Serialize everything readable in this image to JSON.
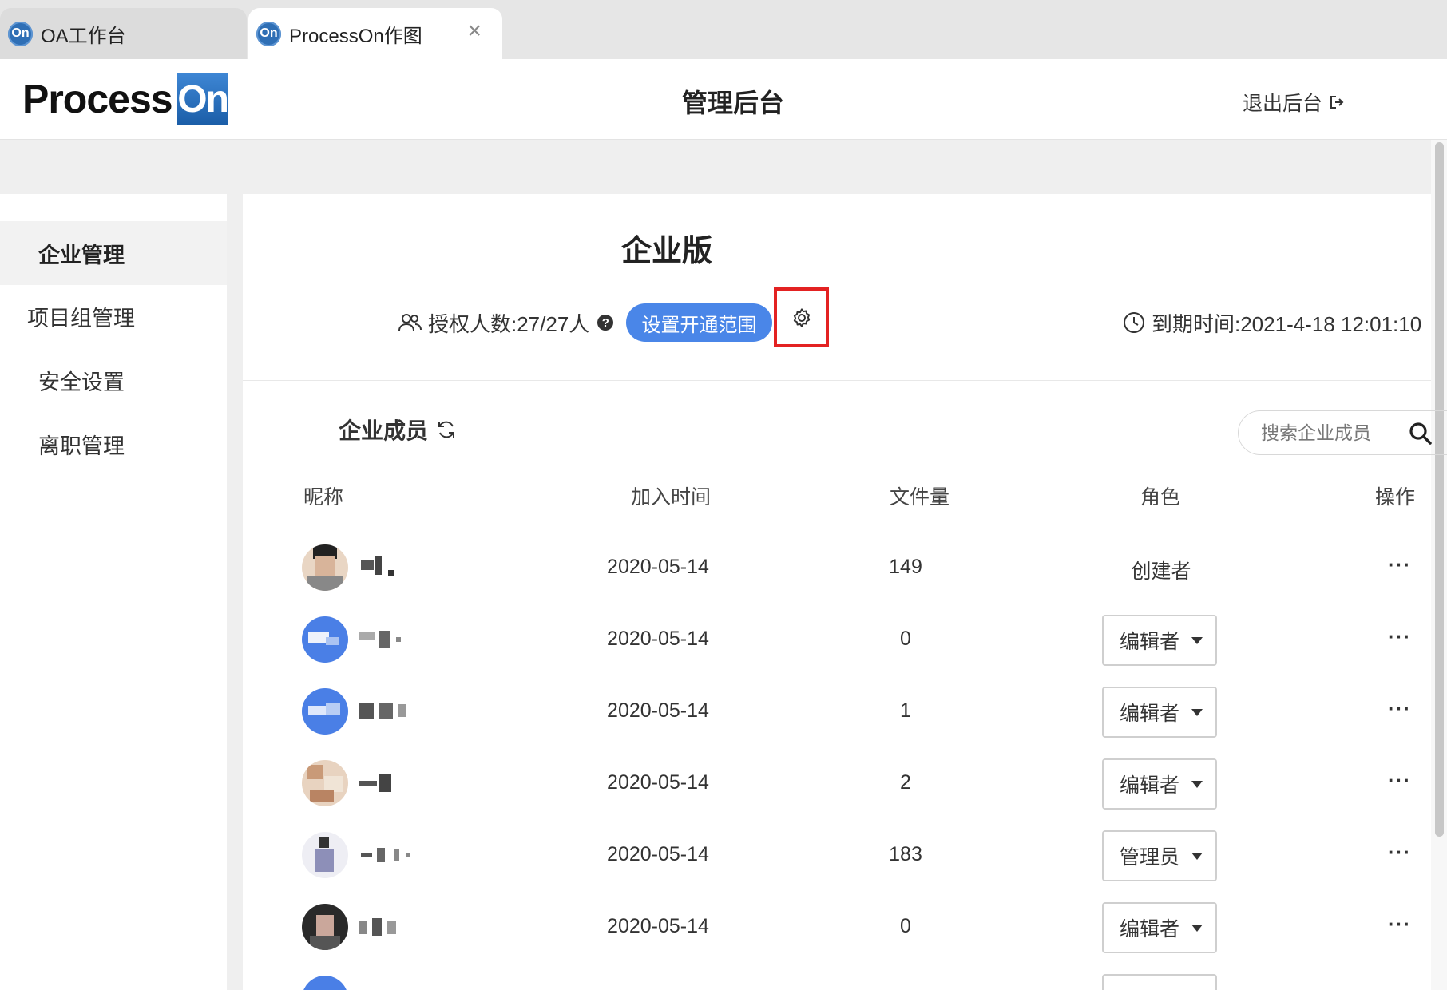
{
  "tabs": [
    {
      "icon_text": "On",
      "label": "OA工作台",
      "active": false
    },
    {
      "icon_text": "On",
      "label": "ProcessOn作图",
      "active": true
    }
  ],
  "header": {
    "logo_process": "Process",
    "logo_on": "On",
    "title": "管理后台",
    "logout_label": "退出后台"
  },
  "sidebar": {
    "items": [
      {
        "label": "企业管理",
        "active": true
      },
      {
        "label": "项目组管理",
        "active": false
      },
      {
        "label": "安全设置",
        "active": false
      },
      {
        "label": "离职管理",
        "active": false
      }
    ]
  },
  "main": {
    "edition": "企业版",
    "license_text": "授权人数:27/27人",
    "help_icon": "?",
    "scope_button": "设置开通范围",
    "expiry_text": "到期时间:2021-4-18 12:01:10",
    "members_title": "企业成员",
    "search_placeholder": "搜索企业成员",
    "columns": [
      "昵称",
      "加入时间",
      "文件量",
      "角色",
      "操作"
    ],
    "rows": [
      {
        "date": "2020-05-14",
        "files": "149",
        "role": "创建者",
        "role_editable": false
      },
      {
        "date": "2020-05-14",
        "files": "0",
        "role": "编辑者",
        "role_editable": true
      },
      {
        "date": "2020-05-14",
        "files": "1",
        "role": "编辑者",
        "role_editable": true
      },
      {
        "date": "2020-05-14",
        "files": "2",
        "role": "编辑者",
        "role_editable": true
      },
      {
        "date": "2020-05-14",
        "files": "183",
        "role": "管理员",
        "role_editable": true
      },
      {
        "date": "2020-05-14",
        "files": "0",
        "role": "编辑者",
        "role_editable": true
      }
    ],
    "more_label": "···"
  },
  "colors": {
    "accent": "#4a86e8",
    "highlight_box": "#e32222",
    "logo_blue": "#2f6fb5"
  },
  "icons": {
    "tab": "processon-tab-icon",
    "logout": "logout-icon",
    "users": "users-icon",
    "gear": "gear-icon",
    "clock": "clock-icon",
    "refresh": "refresh-icon",
    "search": "search-icon"
  }
}
